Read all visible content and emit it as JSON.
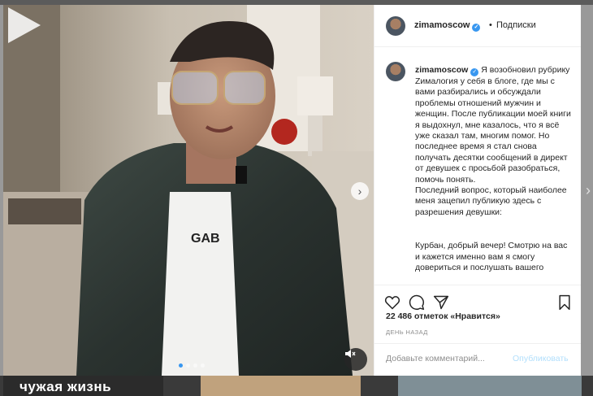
{
  "post": {
    "username": "zimamoscow",
    "separator": "•",
    "follow_label": "Подписки",
    "caption": {
      "username": "zimamoscow",
      "paragraph_1": "Я возобновил рубрику Zималогия у себя в блоге, где мы с вами разбирались и обсуждали проблемы отношений мужчин и женщин. После публикации моей книги я выдохнул, мне казалось, что я всё уже сказал там, многим помог. Но последнее время я стал снова получать десятки сообщений в директ от девушек с просьбой разобраться, помочь понять.",
      "paragraph_2": "Последний вопрос, который наиболее меня зацепил публикую здесь с разрешения девушки:",
      "paragraph_3": "Курбан, добрый вечер! Смотрю на вас и кажется именно вам я смогу довериться и послушать вашего"
    },
    "likes_text": "22 486 отметок «Нравится»",
    "date_text": "день назад",
    "comment_placeholder": "Добавьте комментарий...",
    "publish_label": "Опубликовать"
  },
  "media": {
    "shirt_text": "GAB",
    "carousel_dots": 4,
    "active_dot": 0
  },
  "background": {
    "strip_text": "чужая жизнь",
    "next_arrow": "›"
  },
  "icons": {
    "verified": "verified-badge-icon",
    "like": "heart-icon",
    "comment": "comment-bubble-icon",
    "share": "paper-plane-icon",
    "save": "bookmark-icon",
    "play": "play-icon",
    "mute": "speaker-muted-icon",
    "next": "chevron-right-icon"
  },
  "colors": {
    "accent_blue": "#3897f0",
    "publish_disabled": "#b2dffc",
    "text": "#262626",
    "muted": "#8e8e8e"
  }
}
